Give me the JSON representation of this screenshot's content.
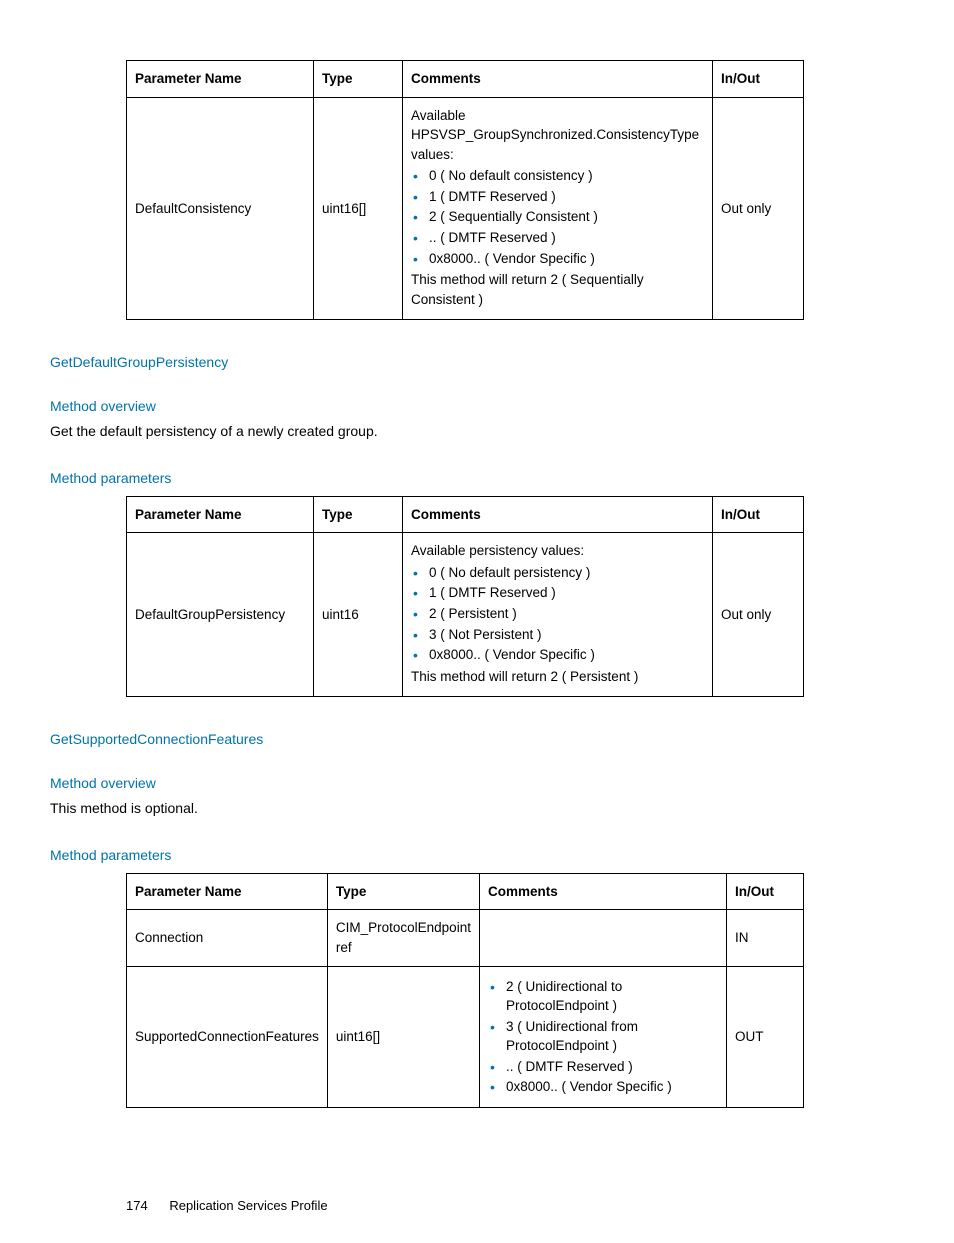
{
  "table1": {
    "headers": [
      "Parameter Name",
      "Type",
      "Comments",
      "In/Out"
    ],
    "row": {
      "name": "DefaultConsistency",
      "type": "uint16[]",
      "intro": "Available HPSVSP_GroupSynchronized.ConsistencyType values:",
      "items": [
        "0 ( No default consistency )",
        "1 ( DMTF Reserved )",
        "2 ( Sequentially Consistent )",
        ".. ( DMTF Reserved )",
        "0x8000.. ( Vendor Specific )"
      ],
      "outro": "This method will return 2 ( Sequentially Consistent )",
      "inout": "Out only"
    }
  },
  "sec2_title": "GetDefaultGroupPersistency",
  "sec2_ov_label": "Method overview",
  "sec2_ov_text": "Get the default persistency of a newly created group.",
  "sec2_mp_label": "Method parameters",
  "table2": {
    "headers": [
      "Parameter Name",
      "Type",
      "Comments",
      "In/Out"
    ],
    "row": {
      "name": "DefaultGroupPersistency",
      "type": "uint16",
      "intro": "Available persistency values:",
      "items": [
        "0 ( No default persistency )",
        "1 ( DMTF Reserved )",
        "2 ( Persistent )",
        "3 ( Not Persistent )",
        "0x8000.. ( Vendor Specific )"
      ],
      "outro": "This method will return 2 ( Persistent )",
      "inout": "Out only"
    }
  },
  "sec3_title": "GetSupportedConnectionFeatures",
  "sec3_ov_label": "Method overview",
  "sec3_ov_text": "This method is optional.",
  "sec3_mp_label": "Method parameters",
  "table3": {
    "headers": [
      "Parameter Name",
      "Type",
      "Comments",
      "In/Out"
    ],
    "rows": [
      {
        "name": "Connection",
        "type": "CIM_ProtocolEndpoint ref",
        "comments_text": "",
        "inout": "IN"
      },
      {
        "name": "SupportedConnectionFeatures",
        "type": "uint16[]",
        "items": [
          "2 ( Unidirectional to ProtocolEndpoint )",
          "3 ( Unidirectional from ProtocolEndpoint )",
          ".. ( DMTF Reserved )",
          "0x8000.. ( Vendor Specific )"
        ],
        "inout": "OUT"
      }
    ]
  },
  "footer_page": "174",
  "footer_title": "Replication Services Profile"
}
